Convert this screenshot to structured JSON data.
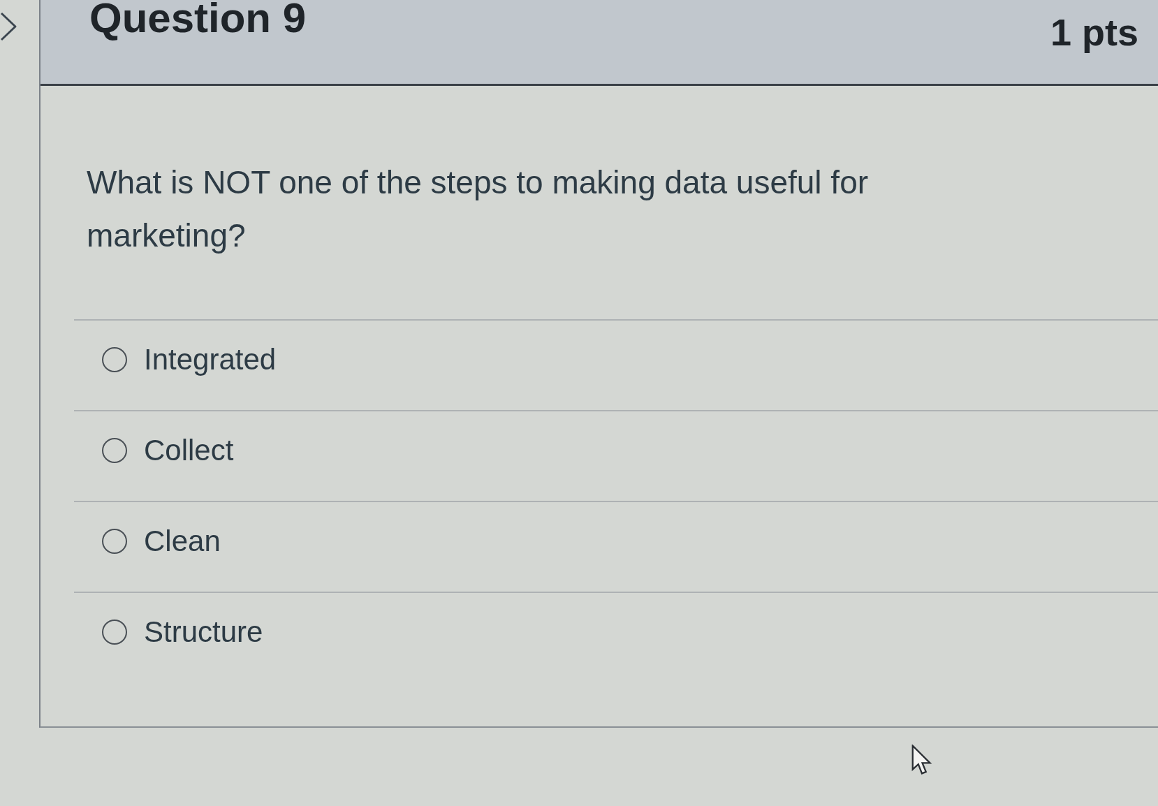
{
  "question": {
    "title": "Question 9",
    "points": "1 pts",
    "text": "What is NOT one of the steps to making data useful for marketing?"
  },
  "answers": [
    {
      "label": "Integrated",
      "selected": false
    },
    {
      "label": "Collect",
      "selected": false
    },
    {
      "label": "Clean",
      "selected": false
    },
    {
      "label": "Structure",
      "selected": false
    }
  ]
}
